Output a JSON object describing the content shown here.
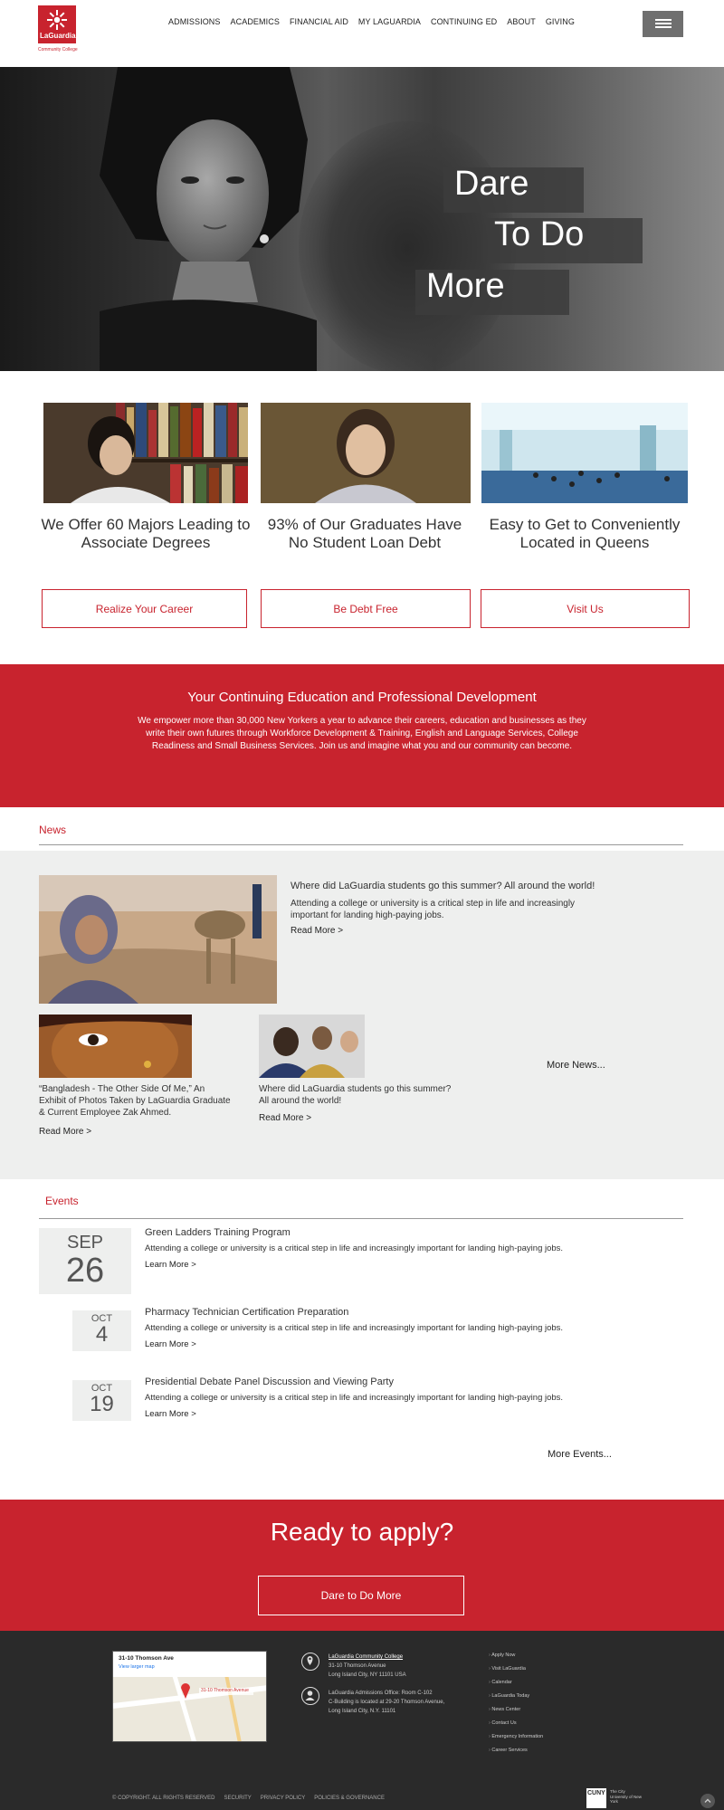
{
  "header": {
    "logo_text": "LaGuardia",
    "logo_sub": "Community College",
    "nav": [
      "ADMISSIONS",
      "ACADEMICS",
      "FINANCIAL AID",
      "MY LAGUARDIA",
      "CONTINUING ED",
      "ABOUT",
      "GIVING"
    ],
    "menu_icon": "hamburger-icon"
  },
  "hero": {
    "line1": "Dare",
    "line2": "To Do",
    "line3": "More"
  },
  "features": [
    {
      "title": "We Offer 60 Majors Leading to Associate Degrees",
      "button": "Realize Your Career"
    },
    {
      "title": "93% of Our Graduates Have No Student Loan Debt",
      "button": "Be Debt Free"
    },
    {
      "title": "Easy to Get to Conveniently Located in Queens",
      "button": "Visit Us"
    }
  ],
  "continuing_ed": {
    "title": "Your Continuing Education and Professional Development",
    "body": "We empower more than 30,000 New Yorkers a year to advance their careers, education and businesses as they write their own futures through Workforce Development & Training, English and Language Services, College Readiness and Small Business Services. Join us and imagine what you and our community can become."
  },
  "news": {
    "heading": "News",
    "featured": {
      "title": "Where did LaGuardia students go this summer? All around the world!",
      "body": "Attending a college or university is a critical step in life and increasingly important for landing high-paying jobs.",
      "link": "Read More >"
    },
    "items": [
      {
        "title": "“Bangladesh - The Other Side Of Me,” An Exhibit of Photos Taken by LaGuardia Graduate & Current Employee Zak Ahmed.",
        "link": "Read More >"
      },
      {
        "title": "Where did LaGuardia students go this summer? All around the world!",
        "link": "Read More >"
      }
    ],
    "more": "More News..."
  },
  "events": {
    "heading": "Events",
    "items": [
      {
        "month": "SEP",
        "day": "26",
        "title": "Green Ladders Training Program",
        "desc": "Attending a college or university is a critical step in life and increasingly important for landing high-paying jobs.",
        "link": "Learn More >"
      },
      {
        "month": "OCT",
        "day": "4",
        "title": "Pharmacy Technician Certification Preparation",
        "desc": "Attending a college or university is a critical step in life and increasingly important for landing high-paying jobs.",
        "link": "Learn More >"
      },
      {
        "month": "OCT",
        "day": "19",
        "title": "Presidential Debate Panel Discussion and Viewing Party",
        "desc": "Attending a college or university is a critical step in life and increasingly important for landing high-paying jobs.",
        "link": "Learn More >"
      }
    ],
    "more": "More Events..."
  },
  "apply": {
    "title": "Ready to apply?",
    "button": "Dare to Do More"
  },
  "footer": {
    "map_title": "31-10 Thomson Ave",
    "map_link": "View larger map",
    "map_pin": "31-10 Thomson Avenue",
    "college_name": "LaGuardia Community College",
    "address1": "31-10 Thomson Avenue",
    "address2": "Long Island City, NY 11101 USA",
    "admissions1": "LaGuardia Admissions Office: Room C-102",
    "admissions2": "C-Building is located at 29-20 Thomson Avenue,",
    "admissions3": "Long Island City, N.Y. 11101",
    "links": [
      "Apply Now",
      "Visit LaGuardia",
      "Calendar",
      "LaGuardia Today",
      "News Center",
      "Contact Us",
      "Emergency Information",
      "Career Services"
    ],
    "bottom": [
      "© COPYRIGHT. ALL RIGHTS RESERVED",
      "SECURITY",
      "PRIVACY POLICY",
      "POLICIES & GOVERNANCE"
    ],
    "cuny": "The City University of New York",
    "cuny_logo": "CUNY"
  },
  "colors": {
    "brand_red": "#c8232e",
    "footer_dark": "#2a2a2a",
    "news_gray": "#eeefee"
  }
}
